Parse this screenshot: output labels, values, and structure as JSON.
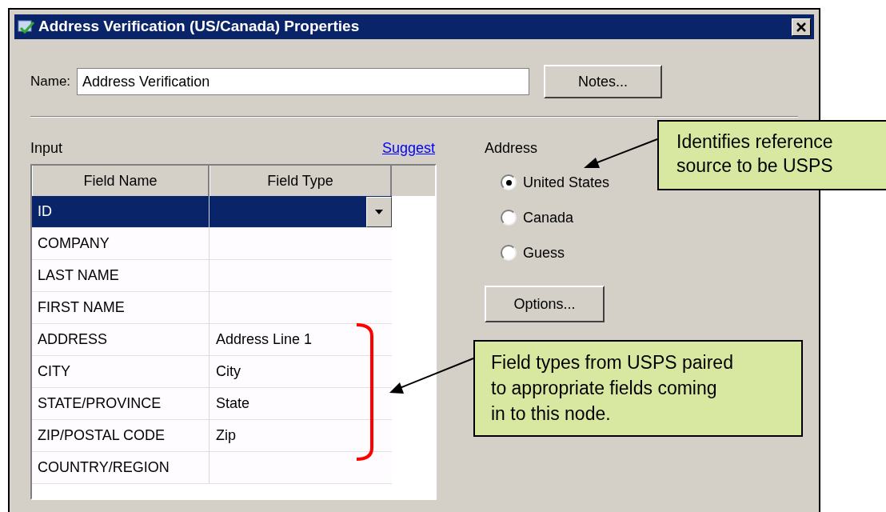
{
  "window": {
    "title": "Address Verification (US/Canada) Properties"
  },
  "name_field": {
    "label": "Name:",
    "value": "Address Verification"
  },
  "notes_button": "Notes...",
  "input": {
    "label": "Input",
    "link": "Suggest",
    "table": {
      "columns": [
        "Field Name",
        "Field Type"
      ],
      "rows": [
        {
          "field_name": "ID",
          "selected": true
        },
        {
          "field_name": "COMPANY",
          "selected": false
        },
        {
          "field_name": "LAST NAME",
          "selected": false
        },
        {
          "field_name": "FIRST NAME",
          "selected": false
        },
        {
          "field_name": "ADDRESS",
          "field_type": "Address Line 1",
          "selected": false
        },
        {
          "field_name": "CITY",
          "field_type": "City",
          "selected": false
        },
        {
          "field_name": "STATE/PROVINCE",
          "field_type": "State",
          "selected": false
        },
        {
          "field_name": "ZIP/POSTAL CODE",
          "field_type": "Zip",
          "selected": false
        },
        {
          "field_name": "COUNTRY/REGION",
          "selected": false
        }
      ]
    }
  },
  "address": {
    "label": "Address",
    "options": [
      {
        "label": "United States",
        "selected": true
      },
      {
        "label": "Canada",
        "selected": false
      },
      {
        "label": "Guess",
        "selected": false
      }
    ],
    "options_button": "Options..."
  },
  "annotations": [
    {
      "text": "Identifies reference\nsource to be USPS"
    },
    {
      "text": "Field types from USPS paired\nto appropriate fields coming\nin to this node."
    }
  ]
}
